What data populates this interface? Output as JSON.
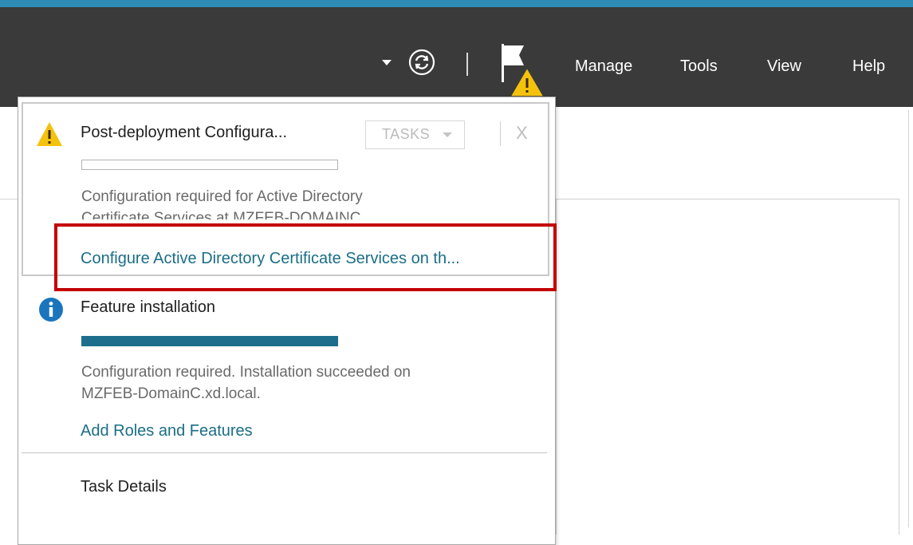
{
  "header": {
    "menu": [
      "Manage",
      "Tools",
      "View",
      "Help"
    ],
    "icons": [
      "chevron-down-icon",
      "refresh-icon",
      "notification-flag-icon",
      "warning-badge-icon"
    ],
    "colors": {
      "background": "#3a3a3a",
      "accent": "#2d8bb5"
    }
  },
  "notifications": [
    {
      "icon": "warning-icon",
      "title": "Post-deployment Configura...",
      "tasks_label": "TASKS",
      "close_label": "X",
      "progress": 0.0,
      "description": [
        "Configuration required for Active Directory",
        "Certificate Services at MZFEB-DOMAINC"
      ],
      "link": "Configure Active Directory Certificate Services on th..."
    },
    {
      "icon": "info-icon",
      "title": "Feature installation",
      "progress": 1.0,
      "description": [
        "Configuration required. Installation succeeded on",
        "MZFEB-DomainC.xd.local."
      ],
      "link": "Add Roles and Features"
    }
  ],
  "footer": {
    "task_details": "Task Details"
  },
  "colors": {
    "link": "#1a6e86",
    "progress": "#1c6e8c",
    "highlight": "#c40000",
    "warning": "#f4c20d",
    "info": "#1b75bc"
  }
}
